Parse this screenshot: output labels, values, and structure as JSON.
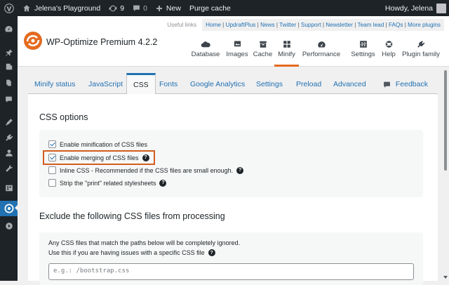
{
  "adminbar": {
    "site_name": "Jelena's Playground",
    "updates_count": "9",
    "comments_count": "0",
    "new_label": "New",
    "purge_label": "Purge cache",
    "howdy": "Howdy, Jelena"
  },
  "header": {
    "useful_links_label": "Useful links",
    "useful_links": [
      "Home",
      "UpdraftPlus",
      "News",
      "Twitter",
      "Support",
      "Newsletter",
      "Team lead",
      "FAQs",
      "More plugins"
    ],
    "product_title": "WP-Optimize Premium 4.2.2",
    "brand_color": "#e46b1f",
    "nav": [
      {
        "label": "Database",
        "icon": "cloud-icon"
      },
      {
        "label": "Images",
        "icon": "images-icon"
      },
      {
        "label": "Cache",
        "icon": "archive-icon"
      },
      {
        "label": "Minify",
        "icon": "grid-icon",
        "active": true
      },
      {
        "label": "Performance",
        "icon": "dashboard-icon"
      },
      {
        "label": "Settings",
        "icon": "settings-icon"
      },
      {
        "label": "Help",
        "icon": "help-icon"
      },
      {
        "label": "Plugin family",
        "icon": "plugin-icon"
      }
    ]
  },
  "tabs": {
    "items": [
      "Minify status",
      "JavaScript",
      "CSS",
      "Fonts",
      "Google Analytics",
      "Settings",
      "Preload",
      "Advanced"
    ],
    "active": "CSS",
    "feedback": "Feedback"
  },
  "css_options": {
    "title": "CSS options",
    "options": [
      {
        "label": "Enable minification of CSS files",
        "checked": true,
        "help": false
      },
      {
        "label": "Enable merging of CSS files",
        "checked": true,
        "help": true
      },
      {
        "label": "Inline CSS - Recommended if the CSS files are small enough.",
        "checked": false,
        "help": true
      },
      {
        "label": "Strip the \"print\" related stylesheets",
        "checked": false,
        "help": true
      }
    ]
  },
  "exclude": {
    "title": "Exclude the following CSS files from processing",
    "desc1": "Any CSS files that match the paths below will be completely ignored.",
    "desc2": "Use this if you are having issues with a specific CSS file",
    "placeholder": "e.g.: /bootstrap.css"
  },
  "colors": {
    "admin_dark": "#1d2327",
    "link_blue": "#2271b1",
    "highlight": "#d35d1e"
  }
}
